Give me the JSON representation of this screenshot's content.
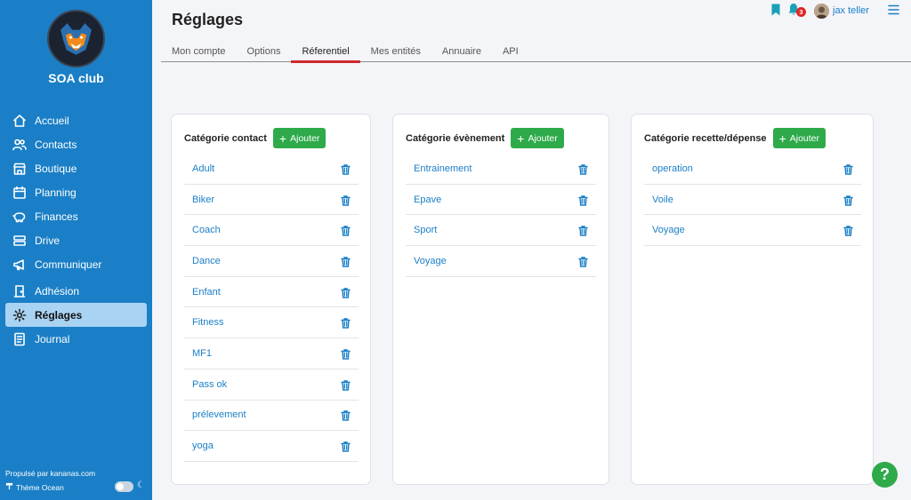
{
  "sidebar": {
    "club_name": "SOA club",
    "items": [
      {
        "label": "Accueil",
        "icon": "home-icon"
      },
      {
        "label": "Contacts",
        "icon": "users-icon"
      },
      {
        "label": "Boutique",
        "icon": "store-icon"
      },
      {
        "label": "Planning",
        "icon": "calendar-icon"
      },
      {
        "label": "Finances",
        "icon": "piggy-bank-icon"
      },
      {
        "label": "Drive",
        "icon": "drive-icon"
      },
      {
        "label": "Communiquer",
        "icon": "megaphone-icon"
      },
      {
        "label": "Adhésion",
        "icon": "door-icon"
      },
      {
        "label": "Réglages",
        "icon": "gear-icon",
        "active": true
      },
      {
        "label": "Journal",
        "icon": "journal-icon"
      }
    ],
    "powered_by": "Propulsé par kananas.com",
    "theme_label": "Thème Ocean"
  },
  "header": {
    "title": "Réglages",
    "notification_count": "3",
    "username": "jax teller"
  },
  "tabs": [
    {
      "label": "Mon compte"
    },
    {
      "label": "Options"
    },
    {
      "label": "Réferentiel",
      "active": true
    },
    {
      "label": "Mes entités"
    },
    {
      "label": "Annuaire"
    },
    {
      "label": "API"
    }
  ],
  "add_label": "Ajouter",
  "cards": [
    {
      "title": "Catégorie contact",
      "items": [
        "Adult",
        "Biker",
        "Coach",
        "Dance",
        "Enfant",
        "Fitness",
        "MF1",
        "Pass ok",
        "prélevement",
        "yoga"
      ]
    },
    {
      "title": "Catégorie évènement",
      "items": [
        "Entrainement",
        "Epave",
        "Sport",
        "Voyage"
      ]
    },
    {
      "title": "Catégorie recette/dépense",
      "items": [
        "operation",
        "Voile",
        "Voyage"
      ]
    }
  ],
  "help_label": "?",
  "colors": {
    "sidebar": "#1a7fc6",
    "accent_green": "#2eaa4a",
    "link_blue": "#1a7fc6",
    "tab_underline": "#d0282e"
  }
}
